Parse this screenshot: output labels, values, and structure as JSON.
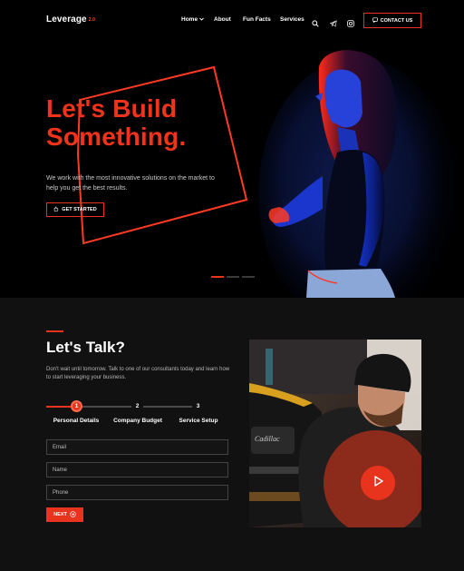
{
  "nav": {
    "logo": "Leverage",
    "logo_version": "2.0",
    "items": [
      {
        "label": "Home",
        "has_dropdown": true
      },
      {
        "label": "About"
      },
      {
        "label": "Fun Facts"
      },
      {
        "label": "Services"
      }
    ],
    "icons": [
      "search-icon",
      "telegram-icon",
      "instagram-icon"
    ],
    "contact_label": "CONTACT US"
  },
  "hero": {
    "title_line1": "Let's Build",
    "title_line2": "Something.",
    "subtitle": "We work with the most innovative solutions on the market to help you get the best results.",
    "cta_label": "GET STARTED",
    "slides": 3,
    "active_slide": 1
  },
  "talk": {
    "title": "Let's Talk?",
    "description": "Don't wait until tomorrow. Talk to one of our consultants today and learn how to start leveraging your business.",
    "steps": [
      {
        "number": "1",
        "label": "Personal Details",
        "active": true
      },
      {
        "number": "2",
        "label": "Company Budget",
        "active": false
      },
      {
        "number": "3",
        "label": "Service Setup",
        "active": false
      }
    ],
    "fields": [
      {
        "placeholder": "Email"
      },
      {
        "placeholder": "Name"
      },
      {
        "placeholder": "Phone"
      }
    ],
    "next_label": "NEXT"
  },
  "colors": {
    "accent": "#e8341c",
    "background": "#000000",
    "section_background": "#111111"
  }
}
